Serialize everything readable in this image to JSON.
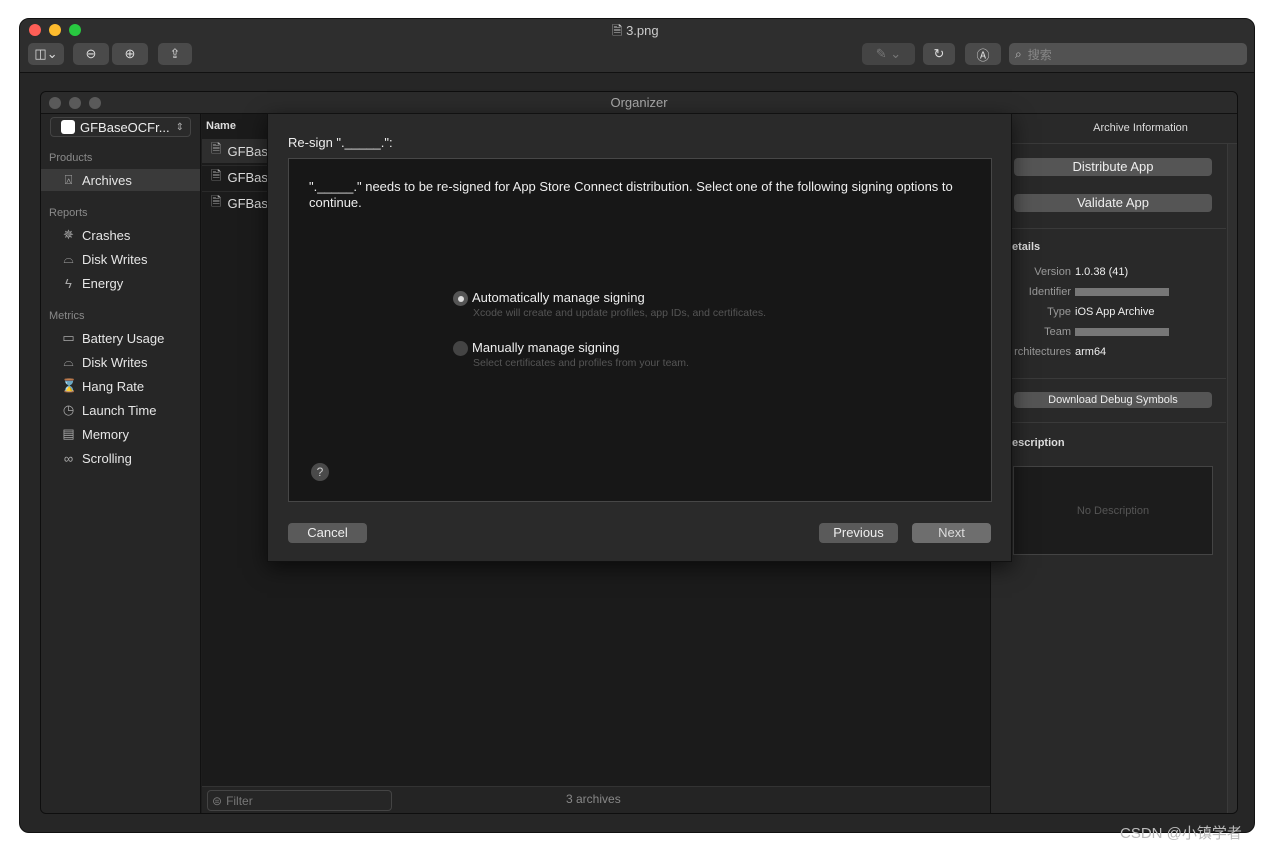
{
  "viewer": {
    "file_title": "3.png",
    "search_placeholder": "搜索"
  },
  "organizer": {
    "title": "Organizer",
    "scheme": "GFBaseOCFr...",
    "sidebar": {
      "products_label": "Products",
      "products": [
        {
          "label": "Archives",
          "icon": "archive-icon",
          "selected": true
        }
      ],
      "reports_label": "Reports",
      "reports": [
        {
          "label": "Crashes",
          "icon": "crash-icon"
        },
        {
          "label": "Disk Writes",
          "icon": "disk-icon"
        },
        {
          "label": "Energy",
          "icon": "bolt-icon"
        }
      ],
      "metrics_label": "Metrics",
      "metrics": [
        {
          "label": "Battery Usage",
          "icon": "battery-icon"
        },
        {
          "label": "Disk Writes",
          "icon": "disk-icon"
        },
        {
          "label": "Hang Rate",
          "icon": "hourglass-icon"
        },
        {
          "label": "Launch Time",
          "icon": "clock-icon"
        },
        {
          "label": "Memory",
          "icon": "memory-icon"
        },
        {
          "label": "Scrolling",
          "icon": "scroll-icon"
        }
      ]
    },
    "list": {
      "header": "Name",
      "rows": [
        "GFBas",
        "GFBas",
        "GFBas"
      ],
      "filter_placeholder": "Filter",
      "count": "3 archives"
    },
    "info": {
      "title": "Archive Information",
      "distribute": "Distribute App",
      "validate": "Validate App",
      "details_label": "etails",
      "version_key": "Version",
      "version": "1.0.38 (41)",
      "identifier_key": "Identifier",
      "type_key": "Type",
      "type": "iOS App Archive",
      "team_key": "Team",
      "arch_key": "rchitectures",
      "arch": "arm64",
      "debug": "Download Debug Symbols",
      "description_label": "escription",
      "no_description": "No Description"
    }
  },
  "sheet": {
    "title": "Re-sign \"._____.\":",
    "message": "\"._____.\" needs to be re-signed for App Store Connect distribution. Select one of the following signing options to continue.",
    "options": [
      {
        "label": "Automatically manage signing",
        "desc": "Xcode will create and update profiles, app IDs, and certificates.",
        "selected": true
      },
      {
        "label": "Manually manage signing",
        "desc": "Select certificates and profiles from your team.",
        "selected": false
      }
    ],
    "help": "?",
    "cancel": "Cancel",
    "previous": "Previous",
    "next": "Next"
  },
  "watermark": "CSDN @小镇学者"
}
